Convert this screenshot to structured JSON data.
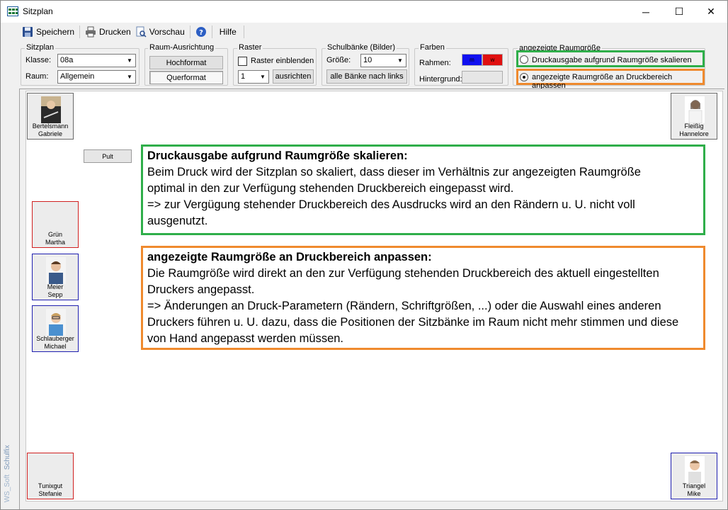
{
  "window": {
    "title": "Sitzplan",
    "controls": {
      "minimize": "─",
      "maximize": "☐",
      "close": "✕"
    }
  },
  "toolbar": {
    "save_label": "Speichern",
    "print_label": "Drucken",
    "preview_label": "Vorschau",
    "help_label": "Hilfe"
  },
  "sitzplan_group": {
    "title": "Sitzplan",
    "klasse_label": "Klasse:",
    "klasse_value": "08a",
    "raum_label": "Raum:",
    "raum_value": "Allgemein"
  },
  "ausrichtung_group": {
    "title": "Raum-Ausrichtung",
    "hochformat": "Hochformat",
    "querformat": "Querformat"
  },
  "raster_group": {
    "title": "Raster",
    "show_label": "Raster einblenden",
    "size_value": "1",
    "align_label": "ausrichten"
  },
  "schulbaenke_group": {
    "title": "Schulbänke (Bilder)",
    "size_label": "Größe:",
    "size_value": "10",
    "align_all_label": "alle Bänke nach links"
  },
  "farben_group": {
    "title": "Farben",
    "rahmen_label": "Rahmen:",
    "rahmen_m": "m",
    "rahmen_w": "w",
    "hintergrund_label": "Hintergrund:",
    "colors": {
      "male": "#1010f0",
      "female": "#e01010"
    }
  },
  "raumgroesse_group": {
    "title": "angezeigte Raumgröße",
    "option_scale": "Druckausgabe aufgrund Raumgröße skalieren",
    "option_fit": "angezeigte Raumgröße an Druckbereich anpassen",
    "selected": "fit"
  },
  "sidebar": {
    "brand": "Schulfix",
    "vendor": "WS_Soft"
  },
  "room": {
    "pult_label": "Pult",
    "students": [
      {
        "last": "Bertelsmann",
        "first": "Gabriele",
        "frame": "gray",
        "photo": true
      },
      {
        "last": "Fleißig",
        "first": "Hannelore",
        "frame": "gray",
        "photo": true
      },
      {
        "last": "Grün",
        "first": "Martha",
        "frame": "red",
        "photo": false
      },
      {
        "last": "Meier",
        "first": "Sepp",
        "frame": "blue",
        "photo": true
      },
      {
        "last": "Schlauberger",
        "first": "Michael",
        "frame": "blue",
        "photo": true
      },
      {
        "last": "Tunixgut",
        "first": "Stefanie",
        "frame": "red",
        "photo": false
      },
      {
        "last": "Triangel",
        "first": "Mike",
        "frame": "blue",
        "photo": true
      }
    ]
  },
  "info_boxes": {
    "scale": {
      "heading": "Druckausgabe aufgrund Raumgröße skalieren:",
      "line1": "Beim Druck wird der Sitzplan so skaliert, dass dieser im Verhältnis zur angezeigten Raumgröße",
      "line2": "optimal in den zur Verfügung stehenden Druckbereich eingepasst wird.",
      "line3": "=> zur Vergügung stehender Druckbereich des Ausdrucks wird an den Rändern u. U. nicht voll",
      "line4": "ausgenutzt."
    },
    "fit": {
      "heading": "angezeigte Raumgröße an Druckbereich anpassen:",
      "line1": "Die Raumgröße wird direkt an den zur Verfügung stehenden Druckbereich des aktuell eingestellten",
      "line2": "Druckers angepasst.",
      "line3": "=> Änderungen an Druck-Parametern (Rändern, Schriftgrößen, ...) oder die Auswahl eines anderen",
      "line4": "Druckers führen u. U. dazu, dass die Positionen der Sitzbänke im Raum nicht mehr stimmen und diese",
      "line5": "von Hand angepasst werden müssen."
    }
  }
}
